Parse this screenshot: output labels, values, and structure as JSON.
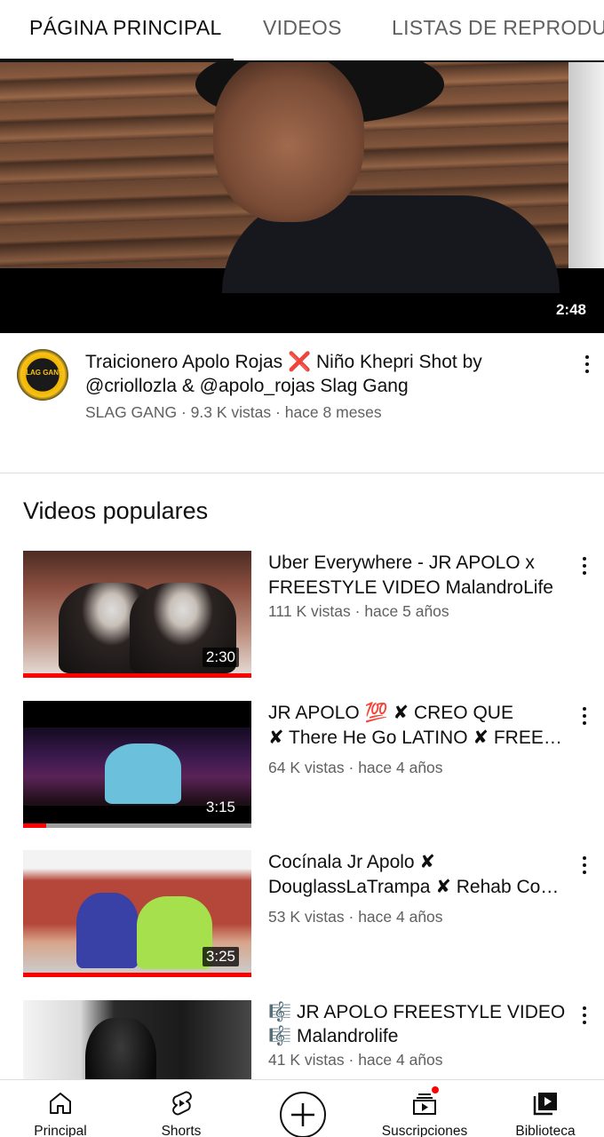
{
  "tabs": [
    {
      "label": "PÁGINA PRINCIPAL",
      "active": true
    },
    {
      "label": "VIDEOS",
      "active": false
    },
    {
      "label": "LISTAS DE REPRODUCCIÓN",
      "active": false
    }
  ],
  "featured": {
    "duration": "2:48",
    "title_line1": "Traicionero Apolo Rojas ❌ Niño Khepri Shot by",
    "title_line2": "@criollozla & @apolo_rojas Slag Gang",
    "channel": "SLAG GANG",
    "views": "9.3 K vistas",
    "age": "hace 8 meses",
    "avatar_text": "SLAG GANG"
  },
  "section_title": "Videos populares",
  "videos": [
    {
      "title_line1": "Uber Everywhere - JR APOLO x",
      "title_line2": "FREESTYLE VIDEO MalandroLife",
      "views": "111 K vistas",
      "age": "hace 5 años",
      "duration": "2:30",
      "progress": 1.0
    },
    {
      "title_line1": "JR APOLO 💯 ✘ CREO QUE",
      "title_line2": "✘ There He Go LATINO ✘ FREE…",
      "views": "64 K vistas",
      "age": "hace 4 años",
      "duration": "3:15",
      "progress": 0.1
    },
    {
      "title_line1": "Cocínala Jr Apolo ✘",
      "title_line2": "DouglassLaTrampa ✘ Rehab Co…",
      "views": "53 K vistas",
      "age": "hace 4 años",
      "duration": "3:25",
      "progress": 1.0
    },
    {
      "title_line1": "🎼 JR APOLO FREESTYLE VIDEO",
      "title_line2": "🎼 Malandrolife",
      "views": "41 K vistas",
      "age": "hace 4 años",
      "duration": "",
      "progress": 0
    }
  ],
  "meta_separator": "·",
  "bottom_nav": [
    {
      "label": "Principal",
      "icon": "home-icon"
    },
    {
      "label": "Shorts",
      "icon": "shorts-icon"
    },
    {
      "label": "",
      "icon": "create-icon"
    },
    {
      "label": "Suscripciones",
      "icon": "subscriptions-icon",
      "notification": true
    },
    {
      "label": "Biblioteca",
      "icon": "library-icon"
    }
  ],
  "colors": {
    "text_primary": "#0f0f0f",
    "text_secondary": "#606060",
    "progress_red": "#ff0000",
    "divider": "#dddddd"
  }
}
